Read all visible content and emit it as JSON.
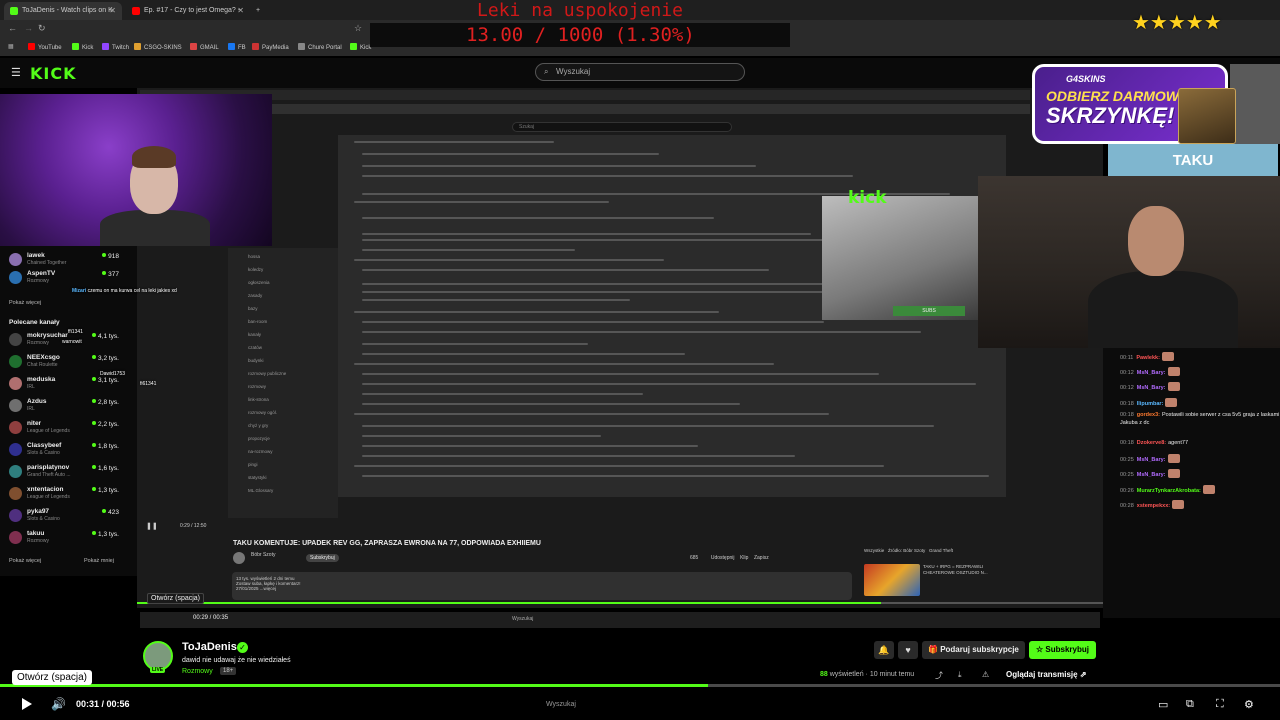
{
  "browser": {
    "tabs": [
      {
        "title": "ToJaDenis - Watch clips on K",
        "color": "#53fc18"
      },
      {
        "title": "Ep. #17 - Czy to jest Omega? - YouT",
        "color": "#ff0000"
      }
    ],
    "new_tab": "+",
    "bookmarks": [
      "YouTube",
      "Kick",
      "Twitch",
      "CSGO-SKINS",
      "GMAIL",
      "FB",
      "PayMedia",
      "Chure Portal",
      "Kick"
    ]
  },
  "overlay": {
    "leki_title": "Leki na uspokojenie",
    "leki_counter": "13.00 / 1000 (1.30%)",
    "stars": "★★★★★"
  },
  "kick": {
    "logo": "KICK",
    "search_placeholder": "Wyszukaj"
  },
  "ad": {
    "brand": "G4SKINS",
    "line1": "ODBIERZ DARMOWĄ",
    "line2": "SKRZYNKĘ!",
    "code": "TAKU"
  },
  "cam_overlay": {
    "kick_label": "kick",
    "subs_label": "SUBS"
  },
  "inner_youtube": {
    "search": "Szukaj",
    "video_title": "TAKU KOMENTUJE: UPADEK REV GG, ZAPRASZA EWRONA NA 77, ODPOWIADA EXHIIEMU",
    "channel": "Bóbr Szoty",
    "subscribe": "Subskrybuj",
    "views_line": "13 tys. wyświetleń  2 dni temu",
    "desc_line": "Zostaw suba, łapkę i komentarz!",
    "date_line": "27/01/2025 ...więcej",
    "actions": [
      "685",
      "Udostępnij",
      "Klip",
      "Zapisz"
    ],
    "sugg_tabs": [
      "Wszystkie",
      "Źródło: Bóbr Szoty",
      "Grand Theft"
    ],
    "sugg_title": "TAKU + IRPG = REZPRAWILI CHEATEROWE OSZTUDIO N...",
    "time": "0:29 / 12:50",
    "tooltip": "Otwórz (spacja)",
    "inner_time": "00:29 / 00:35",
    "taskbar_search": "Wyszukaj",
    "progress_pct": 0.03,
    "sidebar_items": [
      "hossa",
      "koledzy",
      "ogłoszenia",
      "zasady",
      "bazy",
      "ban-room",
      "kanały",
      "czatów",
      "budynki",
      "rozmowy publiczne",
      "rozmowy",
      "link-strona",
      "rozmowy ogól.",
      "chyż y gry",
      "propozycje",
      "na-rozmowy",
      "pingi",
      "statystyki",
      "ML.Glossary"
    ]
  },
  "sidebar": {
    "channels": [
      {
        "name": "lawek",
        "category": "Chained Together",
        "count": "918",
        "color": "#8a6fb0"
      },
      {
        "name": "AspenTV",
        "category": "Rozmowy",
        "count": "377",
        "color": "#2a6fb0"
      },
      {
        "name": "mokrysuchar",
        "category": "Rozmowy",
        "count": "4,1 tys.",
        "color": "#444"
      },
      {
        "name": "NEEXcsgo",
        "category": "Chat Roulette",
        "count": "3,2 tys.",
        "color": "#1f6f2f"
      },
      {
        "name": "meduska",
        "category": "IRL",
        "count": "3,1 tys.",
        "color": "#b06f6f"
      },
      {
        "name": "Azdus",
        "category": "IRL",
        "count": "2,8 tys.",
        "color": "#6f6f6f"
      },
      {
        "name": "niter",
        "category": "League of Legends",
        "count": "2,2 tys.",
        "color": "#8f3f3f"
      },
      {
        "name": "Classybeef",
        "category": "Slots & Casino",
        "count": "1,8 tys.",
        "color": "#2f2f8f"
      },
      {
        "name": "parisplatynov",
        "category": "Grand Theft Auto ...",
        "count": "1,6 tys.",
        "color": "#2f7f7f"
      },
      {
        "name": "xntentacion",
        "category": "League of Legends",
        "count": "1,3 tys.",
        "color": "#7f4f2f"
      },
      {
        "name": "pyka97",
        "category": "Slots & Casino",
        "count": "423",
        "color": "#4f2f7f"
      },
      {
        "name": "takuu",
        "category": "Rozmowy",
        "count": "1,3 tys.",
        "color": "#7f2f4f"
      }
    ],
    "show_more": "Pokaż więcej",
    "recommended": "Polecane kanały",
    "show_more2": "Pokaż więcej",
    "show_less": "Pokaż mniej"
  },
  "left_overlay_chat": [
    {
      "user": "Mizari",
      "text": "czemu on ma kurwa cel na leki jakies xd"
    },
    {
      "user": "",
      "text": "ffi1341"
    },
    {
      "user": "",
      "text": "warnowit"
    },
    {
      "user": "",
      "text": "Dawid1753"
    },
    {
      "user": "",
      "text": "fi61341"
    }
  ],
  "chat": [
    {
      "time": "00:11",
      "user": "Pawlekk:",
      "text": "",
      "color": "#ff5555"
    },
    {
      "time": "00:12",
      "user": "MsN_Bary:",
      "text": "",
      "color": "#b26bff"
    },
    {
      "time": "00:12",
      "user": "MsN_Bary:",
      "text": "",
      "color": "#b26bff"
    },
    {
      "time": "00:18",
      "user": "llipumbar:",
      "text": "",
      "color": "#5ab8ff"
    },
    {
      "time": "00:18",
      "user": "gordex3:",
      "text": "Postawili sobie serwer z csa 5v5 graja z laskami Jakuba z dc",
      "color": "#ff7a2f"
    },
    {
      "time": "00:18",
      "user": "Dzokerve8:",
      "text": "agent77",
      "color": "#ff5555"
    },
    {
      "time": "00:25",
      "user": "MsN_Bary:",
      "text": "",
      "color": "#b26bff"
    },
    {
      "time": "00:25",
      "user": "MsN_Bary:",
      "text": "",
      "color": "#b26bff"
    },
    {
      "time": "00:26",
      "user": "MurarzTynkarzAkrobata:",
      "text": "",
      "color": "#53fc18"
    },
    {
      "time": "00:28",
      "user": "xstempekxx:",
      "text": "",
      "color": "#ff5555"
    }
  ],
  "channel": {
    "name": "ToJaDenis",
    "live": "LIVE",
    "title": "dawid nie udawaj że nie wiedziałeś",
    "category": "Rozmowy",
    "age": "18+",
    "gift": "Podaruj subskrypcje",
    "subscribe": "Subskrybuj",
    "views": "88",
    "views_label": "wyświetleń",
    "ago": "10 minut temu",
    "watch": "Oglądaj transmisję"
  },
  "player": {
    "tooltip": "Otwórz (spacja)",
    "time": "00:31 / 00:56",
    "progress_pct": 0.553,
    "taskbar_search": "Wyszukaj"
  }
}
